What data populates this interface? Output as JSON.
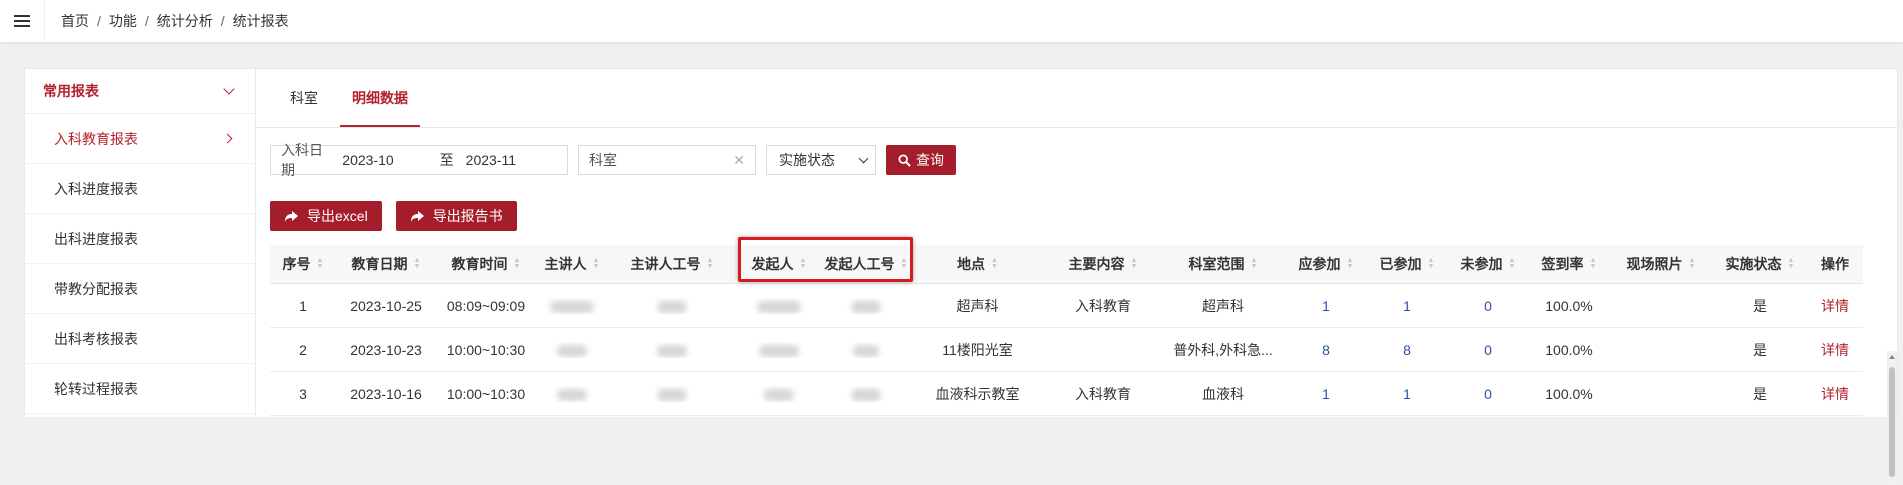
{
  "breadcrumb": {
    "items": [
      "首页",
      "功能",
      "统计分析",
      "统计报表"
    ],
    "separator": "/"
  },
  "sidebar": {
    "heading": "常用报表",
    "items": [
      {
        "label": "入科教育报表",
        "active": true
      },
      {
        "label": "入科进度报表"
      },
      {
        "label": "出科进度报表"
      },
      {
        "label": "带教分配报表"
      },
      {
        "label": "出科考核报表"
      },
      {
        "label": "轮转过程报表"
      }
    ]
  },
  "tabs": [
    {
      "label": "科室"
    },
    {
      "label": "明细数据",
      "active": true
    }
  ],
  "filters": {
    "date_label": "入科日期",
    "date_from": "2023-10",
    "date_to_label": "至",
    "date_to": "2023-11",
    "department": "科室",
    "status": "实施状态",
    "query_label": "查询"
  },
  "actions": {
    "export_excel": "导出excel",
    "export_report": "导出报告书"
  },
  "table": {
    "columns": [
      "序号",
      "教育日期",
      "教育时间",
      "主讲人",
      "主讲人工号",
      "发起人",
      "发起人工号",
      "地点",
      "主要内容",
      "科室范围",
      "应参加",
      "已参加",
      "未参加",
      "签到率",
      "现场照片",
      "实施状态",
      "操作"
    ],
    "rows": [
      {
        "no": "1",
        "date": "2023-10-25",
        "time": "08:09~09:09",
        "place": "超声科",
        "content": "入科教育",
        "scope": "超声科",
        "should": "1",
        "attended": "1",
        "absent": "0",
        "rate": "100.0%",
        "photo": "",
        "status": "是",
        "op": "详情"
      },
      {
        "no": "2",
        "date": "2023-10-23",
        "time": "10:00~10:30",
        "place": "11楼阳光室",
        "content": "",
        "scope": "普外科,外科急...",
        "should": "8",
        "attended": "8",
        "absent": "0",
        "rate": "100.0%",
        "photo": "",
        "status": "是",
        "op": "详情"
      },
      {
        "no": "3",
        "date": "2023-10-16",
        "time": "10:00~10:30",
        "place": "血液科示教室",
        "content": "入科教育",
        "scope": "血液科",
        "should": "1",
        "attended": "1",
        "absent": "0",
        "rate": "100.0%",
        "photo": "",
        "status": "是",
        "op": "详情"
      }
    ]
  },
  "colors": {
    "brand": "#a41d2a",
    "link": "#2c4ea3",
    "highlight": "#d71920"
  }
}
